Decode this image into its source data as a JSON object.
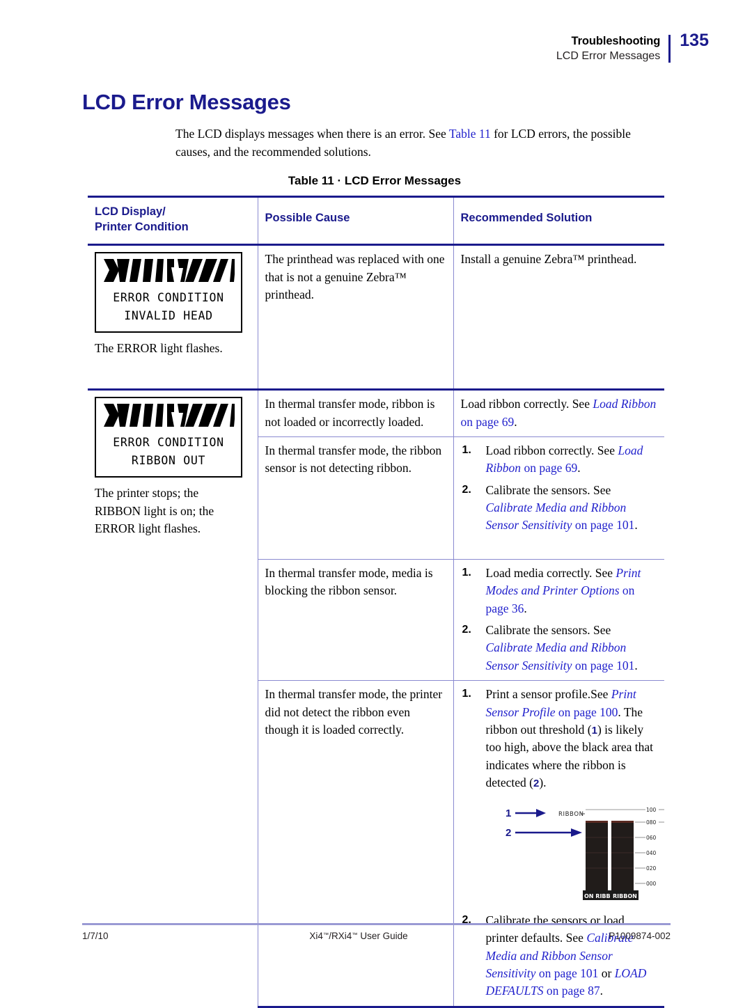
{
  "header": {
    "title": "Troubleshooting",
    "subtitle": "LCD Error Messages",
    "page_number": "135",
    "accent_color": "#1a1a8c"
  },
  "section": {
    "title": "LCD Error Messages",
    "intro_part1": "The LCD displays messages when there is an error. See ",
    "intro_link": "Table 11",
    "intro_part2": " for LCD errors, the possible causes, and the recommended solutions."
  },
  "table": {
    "caption": "Table 11 · LCD Error Messages",
    "headers": {
      "col1_line1": "LCD Display/",
      "col1_line2": "Printer Condition",
      "col2": "Possible Cause",
      "col3": "Recommended Solution"
    },
    "rows": [
      {
        "display": {
          "lcd_line1": "ERROR CONDITION",
          "lcd_line2": "INVALID HEAD",
          "caption": "The ERROR light flashes."
        },
        "cause": "The printhead was replaced with one that is not a genuine Zebra™ printhead.",
        "solution": "Install a genuine Zebra™ printhead."
      },
      {
        "display": {
          "lcd_line1": "ERROR CONDITION",
          "lcd_line2": "RIBBON OUT",
          "caption_line1": "The printer stops; the",
          "caption_line2": "RIBBON light is on; the",
          "caption_line3": "ERROR light flashes."
        },
        "cause_1": "In thermal transfer mode, ribbon is not loaded or incorrectly loaded.",
        "solution_1": {
          "text_before": "Load ribbon correctly. See ",
          "ref_title": "Load Ribbon",
          "ref_page": " on page 69",
          "text_after": "."
        },
        "cause_2": "In thermal transfer mode, the ribbon sensor is not detecting ribbon.",
        "solution_2": [
          {
            "num": "1.",
            "text_before": "Load ribbon correctly. See ",
            "ref_title": "Load Ribbon",
            "ref_page": " on page 69",
            "text_after": "."
          },
          {
            "num": "2.",
            "text_before": "Calibrate the sensors. See ",
            "ref_title": "Calibrate Media and Ribbon Sensor Sensitivity",
            "ref_page": " on page 101",
            "text_after": "."
          }
        ],
        "cause_3": "In thermal transfer mode, media is blocking the ribbon sensor.",
        "solution_3": [
          {
            "num": "1.",
            "text_before": "Load media correctly. See ",
            "ref_title": "Print Modes and Printer Options",
            "ref_page": " on page 36",
            "text_after": "."
          },
          {
            "num": "2.",
            "text_before": "Calibrate the sensors. See ",
            "ref_title": "Calibrate Media and Ribbon Sensor Sensitivity",
            "ref_page": " on page 101",
            "text_after": "."
          }
        ],
        "cause_4": "In thermal transfer mode, the printer did not detect the ribbon even though it is loaded correctly.",
        "solution_4_item1": {
          "num": "1.",
          "text_before": "Print a sensor profile.See ",
          "ref_title": "Print Sensor Profile",
          "ref_page": " on page 100",
          "text_after_a": ". The ribbon out threshold (",
          "callout_a": "1",
          "text_after_b": ") is likely too high, above the black area that indicates where the ribbon is detected (",
          "callout_b": "2",
          "text_after_c": ")."
        },
        "solution_4_item2": {
          "num": "2.",
          "text_before": "Calibrate the sensors or load printer defaults. See ",
          "ref_title": "Calibrate Media and Ribbon Sensor Sensitivity",
          "ref_page": " on page 101",
          "text_middle": " or ",
          "ref_title2": "LOAD DEFAULTS",
          "ref_page2": " on page 87",
          "text_after": "."
        }
      }
    ]
  },
  "sensor_figure": {
    "callout_1": "1",
    "callout_2": "2",
    "ribbon_label": "RIBBON",
    "scale_labels": [
      "100",
      "080",
      "060",
      "040",
      "020",
      "000"
    ],
    "bar1_label": "ON RIBB",
    "bar2_label": "RIBBON"
  },
  "footer": {
    "date": "1/7/10",
    "guide_part1": "Xi4",
    "guide_part2": "/RXi4",
    "guide_part3": " User Guide",
    "doc_number": "P1009874-002"
  }
}
